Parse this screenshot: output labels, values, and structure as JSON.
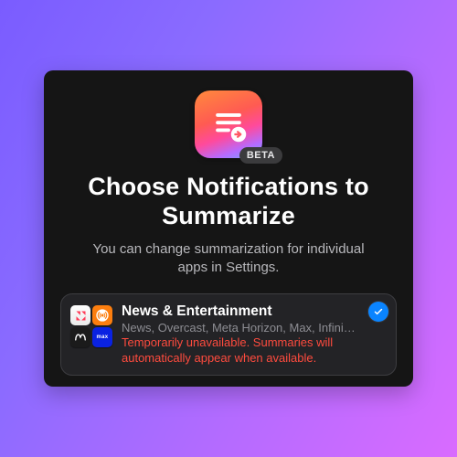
{
  "badge": "BETA",
  "title": "Choose Notifications to Summarize",
  "subtitle": "You can change summarization for individual apps in Settings.",
  "category": {
    "title": "News & Entertainment",
    "apps_line": "News, Overcast, Meta Horizon, Max, Infini…",
    "warning": "Temporarily unavailable. Summaries will automatically appear when available.",
    "selected": true
  },
  "app_tiles": {
    "max_label": "max"
  },
  "colors": {
    "accent": "#0a84ff",
    "warning": "#ff4b3e"
  }
}
